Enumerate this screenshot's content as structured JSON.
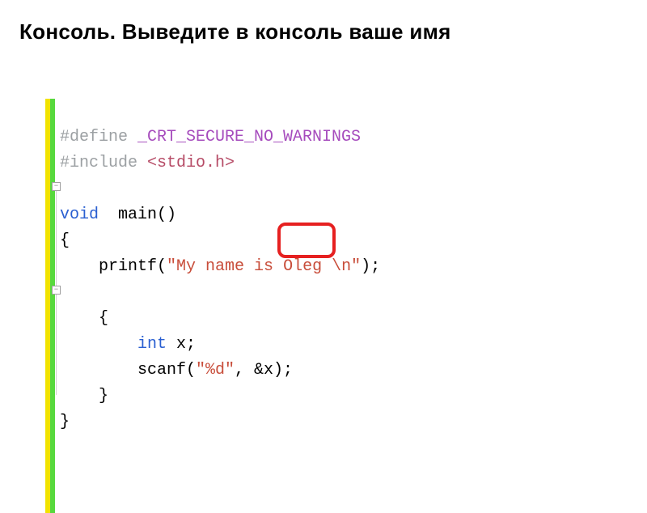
{
  "title": "Консоль. Выведите в консоль ваше имя",
  "code": {
    "l1_directive": "#define ",
    "l1_macro": "_CRT_SECURE_NO_WARNINGS",
    "l2_directive": "#include ",
    "l2_header": "<stdio.h>",
    "l4_kw": "void",
    "l4_fn": "  main()",
    "l5_brace": "{",
    "l6_indent": "    ",
    "l6_fn": "printf(",
    "l6_str_a": "\"My name is ",
    "l6_str_name": "Oleg ",
    "l6_str_b": "\\n\"",
    "l6_close": ");",
    "l8_indent": "    ",
    "l8_brace": "{",
    "l9_indent": "        ",
    "l9_kw": "int",
    "l9_var": " x;",
    "l10_indent": "        ",
    "l10_fn": "scanf(",
    "l10_str": "\"%d\"",
    "l10_close": ", &x);",
    "l11_indent": "    ",
    "l11_brace": "}",
    "l12_brace": "}"
  }
}
